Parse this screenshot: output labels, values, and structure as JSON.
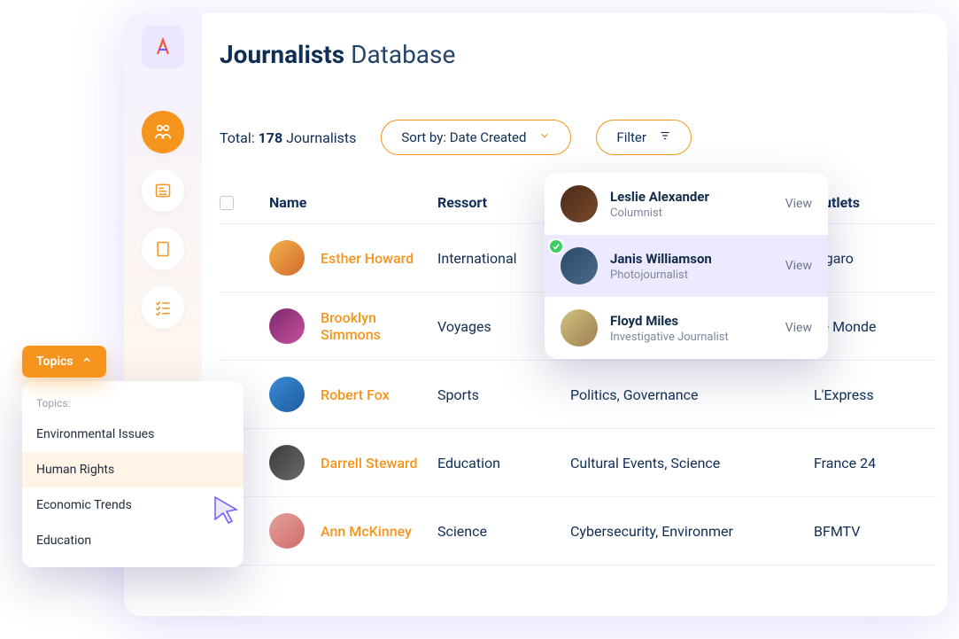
{
  "header": {
    "title_bold": "Journalists",
    "title_light": "Database"
  },
  "summary": {
    "total_label": "Total:",
    "total_value": "178",
    "total_unit": "Journalists"
  },
  "sort": {
    "label": "Sort by: Date Created"
  },
  "filter": {
    "label": "Filter"
  },
  "columns": {
    "name": "Name",
    "ressort": "Ressort",
    "outlets": "Outlets"
  },
  "rows": [
    {
      "name": "Esther Howard",
      "ressort": "International",
      "topics": "",
      "outlet": "Figaro"
    },
    {
      "name": "Brooklyn Simmons",
      "ressort": "Voyages",
      "topics": "",
      "outlet": "Le Monde"
    },
    {
      "name": "Robert Fox",
      "ressort": "Sports",
      "topics": "Politics, Governance",
      "outlet": "L'Express"
    },
    {
      "name": "Darrell Steward",
      "ressort": "Education",
      "topics": "Cultural Events, Science",
      "outlet": "France 24"
    },
    {
      "name": "Ann McKinney",
      "ressort": "Science",
      "topics": "Cybersecurity, Environmer",
      "outlet": "BFMTV"
    }
  ],
  "dropdown": [
    {
      "name": "Leslie Alexander",
      "role": "Columnist",
      "view": "View"
    },
    {
      "name": "Janis Williamson",
      "role": "Photojournalist",
      "view": "View"
    },
    {
      "name": "Floyd Miles",
      "role": "Investigative Journalist",
      "view": "View"
    }
  ],
  "topics_chip": {
    "label": "Topics"
  },
  "topics_menu": {
    "label": "Topics:",
    "items": [
      "Environmental Issues",
      "Human Rights",
      "Economic Trends",
      "Education"
    ]
  }
}
